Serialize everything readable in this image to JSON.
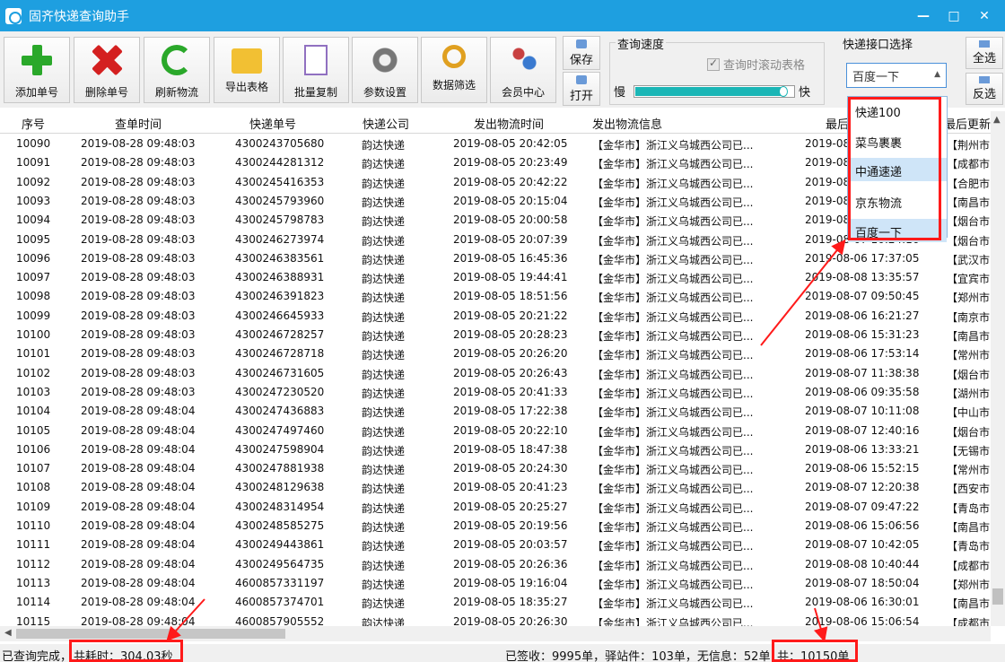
{
  "window": {
    "title": "固齐快递查询助手",
    "controls": [
      "—",
      "□",
      "✕"
    ]
  },
  "toolbar": {
    "buttons": [
      {
        "label": "添加单号",
        "icon": "add-icon"
      },
      {
        "label": "删除单号",
        "icon": "delete-icon"
      },
      {
        "label": "刷新物流",
        "icon": "refresh-icon"
      },
      {
        "label": "导出表格",
        "icon": "export-folder-icon"
      },
      {
        "label": "批量复制",
        "icon": "copy-icon"
      },
      {
        "label": "参数设置",
        "icon": "gear-icon"
      },
      {
        "label": "数据筛选",
        "icon": "search-icon"
      },
      {
        "label": "会员中心",
        "icon": "users-icon"
      }
    ],
    "save_label": "保存",
    "open_label": "打开",
    "speed": {
      "title": "查询速度",
      "scroll_check_label": "查询时滚动表格",
      "scroll_checked": true,
      "slow_label": "慢",
      "fast_label": "快",
      "level": 0.95
    },
    "api": {
      "title": "快递接口选择",
      "selected": "百度一下"
    },
    "select_all_label": "全选",
    "invert_label": "反选"
  },
  "dropdown": {
    "options": [
      "快递100",
      "菜鸟裹裹",
      "中通速递",
      "京东物流",
      "百度一下"
    ],
    "highlighted": [
      "中通速递",
      "百度一下"
    ]
  },
  "table": {
    "headers": [
      "序号",
      "查单时间",
      "快递单号",
      "快递公司",
      "发出物流时间",
      "发出物流信息",
      "最后更新时间",
      "最后更新"
    ],
    "rows": [
      [
        "10090",
        "2019-08-28 09:48:03",
        "4300243705680",
        "韵达快递",
        "2019-08-05 20:42:05",
        "【金华市】浙江义乌城西公司已...",
        "2019-08-06 19:20:23",
        "【荆州市"
      ],
      [
        "10091",
        "2019-08-28 09:48:03",
        "4300244281312",
        "韵达快递",
        "2019-08-05 20:23:49",
        "【金华市】浙江义乌城西公司已...",
        "2019-08-06 17:35:14",
        "【成都市"
      ],
      [
        "10092",
        "2019-08-28 09:48:03",
        "4300245416353",
        "韵达快递",
        "2019-08-05 20:42:22",
        "【金华市】浙江义乌城西公司已...",
        "2019-08-07 11:20:09",
        "【合肥市"
      ],
      [
        "10093",
        "2019-08-28 09:48:03",
        "4300245793960",
        "韵达快递",
        "2019-08-05 20:15:04",
        "【金华市】浙江义乌城西公司已...",
        "2019-08-06 14:40:56",
        "【南昌市"
      ],
      [
        "10094",
        "2019-08-28 09:48:03",
        "4300245798783",
        "韵达快递",
        "2019-08-05 20:00:58",
        "【金华市】浙江义乌城西公司已...",
        "2019-08-07 09:12:38",
        "【烟台市"
      ],
      [
        "10095",
        "2019-08-28 09:48:03",
        "4300246273974",
        "韵达快递",
        "2019-08-05 20:07:39",
        "【金华市】浙江义乌城西公司已...",
        "2019-08-07 10:24:16",
        "【烟台市"
      ],
      [
        "10096",
        "2019-08-28 09:48:03",
        "4300246383561",
        "韵达快递",
        "2019-08-05 16:45:36",
        "【金华市】浙江义乌城西公司已...",
        "2019-08-06 17:37:05",
        "【武汉市"
      ],
      [
        "10097",
        "2019-08-28 09:48:03",
        "4300246388931",
        "韵达快递",
        "2019-08-05 19:44:41",
        "【金华市】浙江义乌城西公司已...",
        "2019-08-08 13:35:57",
        "【宜宾市"
      ],
      [
        "10098",
        "2019-08-28 09:48:03",
        "4300246391823",
        "韵达快递",
        "2019-08-05 18:51:56",
        "【金华市】浙江义乌城西公司已...",
        "2019-08-07 09:50:45",
        "【郑州市"
      ],
      [
        "10099",
        "2019-08-28 09:48:03",
        "4300246645933",
        "韵达快递",
        "2019-08-05 20:21:22",
        "【金华市】浙江义乌城西公司已...",
        "2019-08-06 16:21:27",
        "【南京市"
      ],
      [
        "10100",
        "2019-08-28 09:48:03",
        "4300246728257",
        "韵达快递",
        "2019-08-05 20:28:23",
        "【金华市】浙江义乌城西公司已...",
        "2019-08-06 15:31:23",
        "【南昌市"
      ],
      [
        "10101",
        "2019-08-28 09:48:03",
        "4300246728718",
        "韵达快递",
        "2019-08-05 20:26:20",
        "【金华市】浙江义乌城西公司已...",
        "2019-08-06 17:53:14",
        "【常州市"
      ],
      [
        "10102",
        "2019-08-28 09:48:03",
        "4300246731605",
        "韵达快递",
        "2019-08-05 20:26:43",
        "【金华市】浙江义乌城西公司已...",
        "2019-08-07 11:38:38",
        "【烟台市"
      ],
      [
        "10103",
        "2019-08-28 09:48:03",
        "4300247230520",
        "韵达快递",
        "2019-08-05 20:41:33",
        "【金华市】浙江义乌城西公司已...",
        "2019-08-06 09:35:58",
        "【湖州市"
      ],
      [
        "10104",
        "2019-08-28 09:48:04",
        "4300247436883",
        "韵达快递",
        "2019-08-05 17:22:38",
        "【金华市】浙江义乌城西公司已...",
        "2019-08-07 10:11:08",
        "【中山市"
      ],
      [
        "10105",
        "2019-08-28 09:48:04",
        "4300247497460",
        "韵达快递",
        "2019-08-05 20:22:10",
        "【金华市】浙江义乌城西公司已...",
        "2019-08-07 12:40:16",
        "【烟台市"
      ],
      [
        "10106",
        "2019-08-28 09:48:04",
        "4300247598904",
        "韵达快递",
        "2019-08-05 18:47:38",
        "【金华市】浙江义乌城西公司已...",
        "2019-08-06 13:33:21",
        "【无锡市"
      ],
      [
        "10107",
        "2019-08-28 09:48:04",
        "4300247881938",
        "韵达快递",
        "2019-08-05 20:24:30",
        "【金华市】浙江义乌城西公司已...",
        "2019-08-06 15:52:15",
        "【常州市"
      ],
      [
        "10108",
        "2019-08-28 09:48:04",
        "4300248129638",
        "韵达快递",
        "2019-08-05 20:41:23",
        "【金华市】浙江义乌城西公司已...",
        "2019-08-07 12:20:38",
        "【西安市"
      ],
      [
        "10109",
        "2019-08-28 09:48:04",
        "4300248314954",
        "韵达快递",
        "2019-08-05 20:25:27",
        "【金华市】浙江义乌城西公司已...",
        "2019-08-07 09:47:22",
        "【青岛市"
      ],
      [
        "10110",
        "2019-08-28 09:48:04",
        "4300248585275",
        "韵达快递",
        "2019-08-05 20:19:56",
        "【金华市】浙江义乌城西公司已...",
        "2019-08-06 15:06:56",
        "【南昌市"
      ],
      [
        "10111",
        "2019-08-28 09:48:04",
        "4300249443861",
        "韵达快递",
        "2019-08-05 20:03:57",
        "【金华市】浙江义乌城西公司已...",
        "2019-08-07 10:42:05",
        "【青岛市"
      ],
      [
        "10112",
        "2019-08-28 09:48:04",
        "4300249564735",
        "韵达快递",
        "2019-08-05 20:26:36",
        "【金华市】浙江义乌城西公司已...",
        "2019-08-08 10:40:44",
        "【成都市"
      ],
      [
        "10113",
        "2019-08-28 09:48:04",
        "4600857331197",
        "韵达快递",
        "2019-08-05 19:16:04",
        "【金华市】浙江义乌城西公司已...",
        "2019-08-07 18:50:04",
        "【郑州市"
      ],
      [
        "10114",
        "2019-08-28 09:48:04",
        "4600857374701",
        "韵达快递",
        "2019-08-05 18:35:27",
        "【金华市】浙江义乌城西公司已...",
        "2019-08-06 16:30:01",
        "【南昌市"
      ],
      [
        "10115",
        "2019-08-28 09:48:04",
        "4600857905552",
        "韵达快递",
        "2019-08-05 20:26:30",
        "【金华市】浙江义乌城西公司已...",
        "2019-08-06 15:06:54",
        "【成都市"
      ]
    ]
  },
  "status": {
    "done": "已查询完成，",
    "elapsed": "共耗时：304.03秒",
    "summary": "已签收：9995单，驿站件：103单，无信息：52单，",
    "total": "共：10150单"
  },
  "colors": {
    "titlebar": "#1e9fe0",
    "highlight": "#ff1a1a",
    "slider": "#1ab6b6"
  }
}
